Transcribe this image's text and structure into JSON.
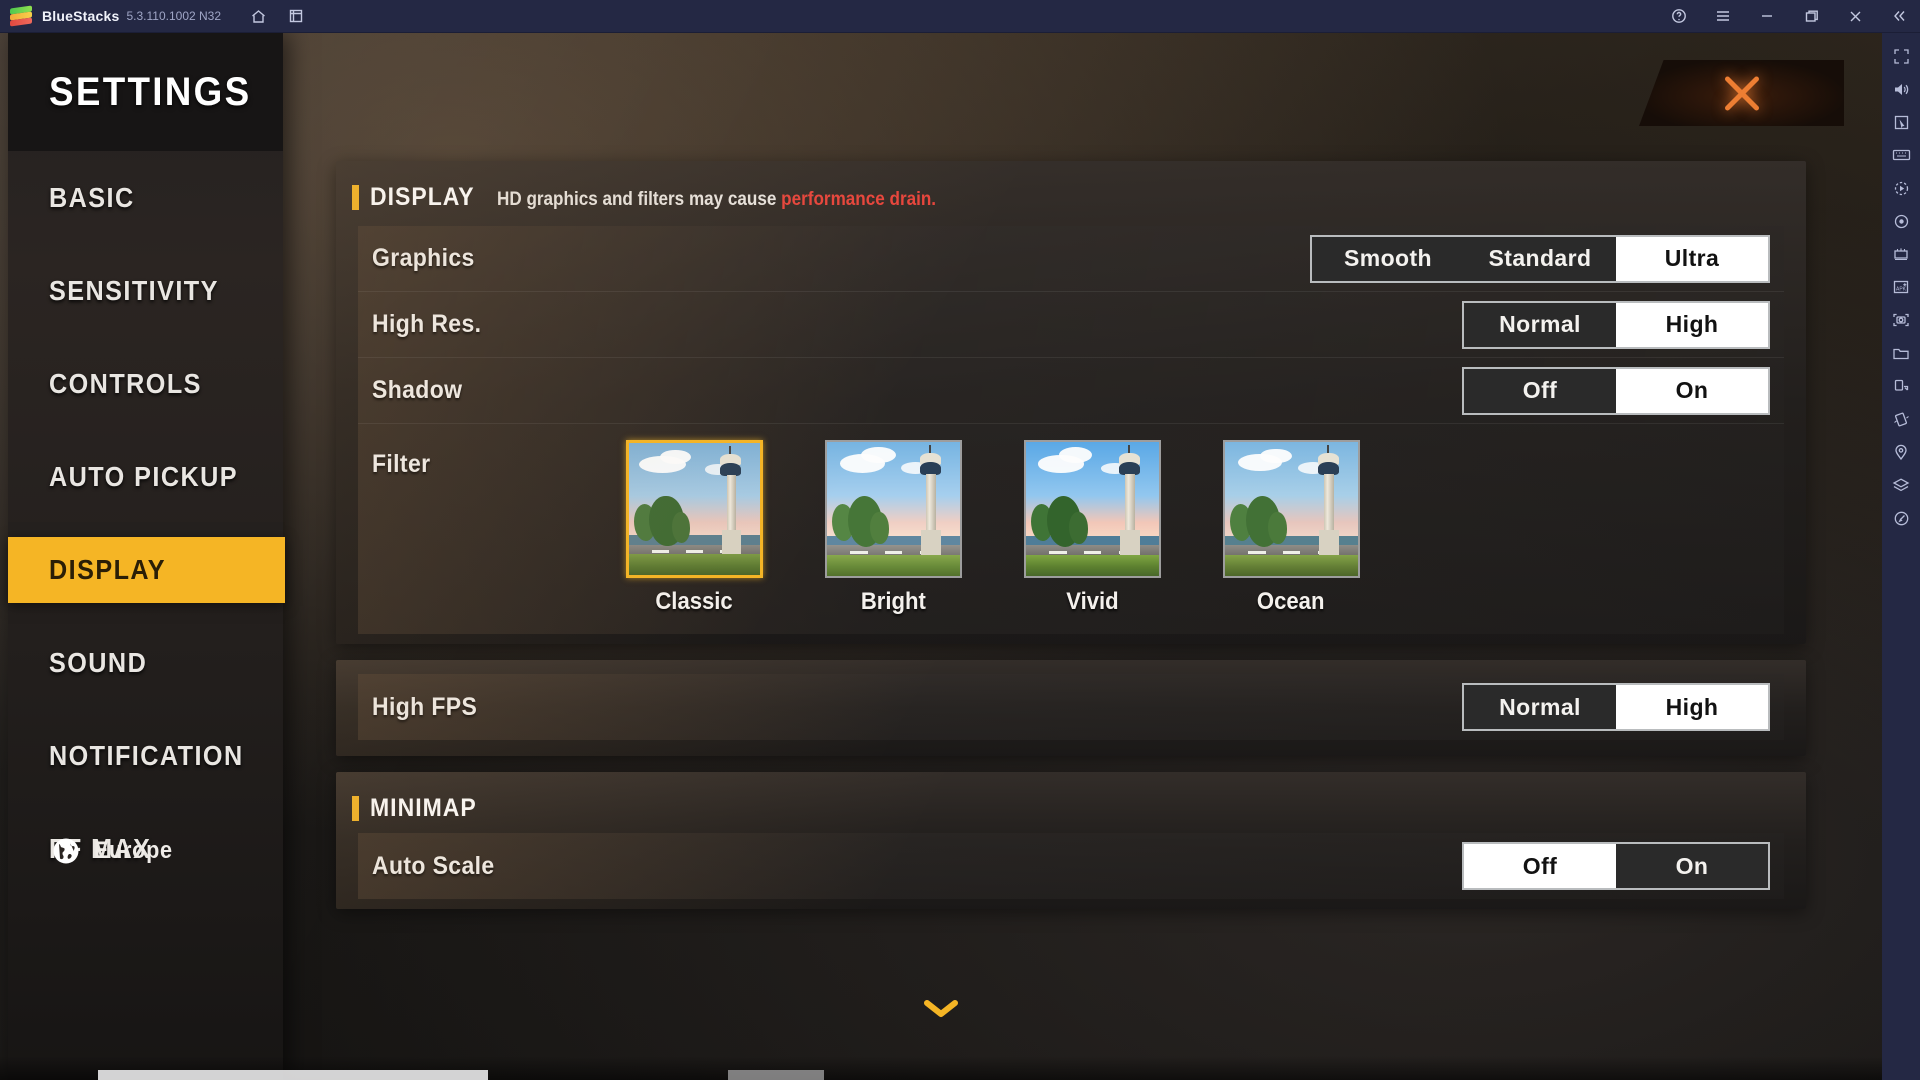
{
  "titlebar": {
    "app_name": "BlueStacks",
    "version": "5.3.110.1002 N32",
    "icons": [
      "home-icon",
      "multi-instance-icon"
    ],
    "window_controls": [
      "help-icon",
      "menu-icon",
      "minimize-icon",
      "maximize-icon",
      "close-icon",
      "collapse-icon"
    ]
  },
  "toolrail": {
    "items": [
      {
        "name": "fullscreen-icon"
      },
      {
        "name": "volume-icon"
      },
      {
        "name": "cursor-icon"
      },
      {
        "name": "keyboard-icon"
      },
      {
        "name": "macro-play-icon"
      },
      {
        "name": "record-icon"
      },
      {
        "name": "multi-instance-manager-icon"
      },
      {
        "name": "install-apk-icon"
      },
      {
        "name": "screenshot-icon"
      },
      {
        "name": "media-folder-icon"
      },
      {
        "name": "rotate-icon"
      },
      {
        "name": "shake-icon"
      },
      {
        "name": "location-icon"
      },
      {
        "name": "layers-icon"
      },
      {
        "name": "eco-mode-icon"
      }
    ]
  },
  "sidebar": {
    "title": "SETTINGS",
    "items": [
      {
        "label": "BASIC",
        "active": false
      },
      {
        "label": "SENSITIVITY",
        "active": false
      },
      {
        "label": "CONTROLS",
        "active": false
      },
      {
        "label": "AUTO PICKUP",
        "active": false
      },
      {
        "label": "DISPLAY",
        "active": true
      },
      {
        "label": "SOUND",
        "active": false
      },
      {
        "label": "NOTIFICATION",
        "active": false
      },
      {
        "label": "FF MAX",
        "active": false
      }
    ],
    "locale": "Europe",
    "active_color": "#F5B525"
  },
  "close_button": {
    "label": "X",
    "color": "#ED7E33"
  },
  "sections": [
    {
      "title": "DISPLAY",
      "note_normal": "HD graphics and filters may cause ",
      "note_warning": "performance drain.",
      "warning_color": "#E8453C",
      "rows": [
        {
          "label": "Graphics",
          "type": "segmented",
          "options": [
            "Smooth",
            "Standard",
            "Ultra"
          ],
          "selected": "Ultra"
        },
        {
          "label": "High Res.",
          "type": "segmented",
          "options": [
            "Normal",
            "High"
          ],
          "selected": "High"
        },
        {
          "label": "Shadow",
          "type": "segmented",
          "options": [
            "Off",
            "On"
          ],
          "selected": "On"
        },
        {
          "label": "Filter",
          "type": "filters",
          "options": [
            "Classic",
            "Bright",
            "Vivid",
            "Ocean"
          ],
          "selected": "Classic"
        }
      ]
    },
    {
      "title": "",
      "rows": [
        {
          "label": "High FPS",
          "type": "segmented",
          "options": [
            "Normal",
            "High"
          ],
          "selected": "High"
        }
      ]
    },
    {
      "title": "MINIMAP",
      "rows": [
        {
          "label": "Auto Scale",
          "type": "segmented",
          "options": [
            "Off",
            "On"
          ],
          "selected": "Off"
        }
      ]
    }
  ],
  "scroll_indicator": "⌄"
}
